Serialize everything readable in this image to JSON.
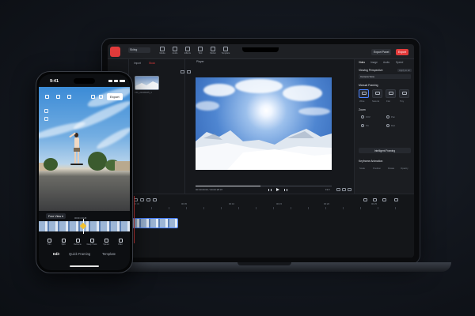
{
  "laptop": {
    "topbar": {
      "project_name": "Skiing",
      "tools": [
        "Media",
        "Audio",
        "Effects",
        "Text",
        "Sticker",
        "Template"
      ],
      "share_label": "Export Panel",
      "export_label": "Export"
    },
    "media": {
      "tabs": [
        "Import",
        "Stock"
      ],
      "clip_caption": "VID_20230105_1"
    },
    "preview": {
      "label": "Player",
      "timecode": "00:00:09:00 / 00:00:28:07",
      "zoom": "Fit ▾"
    },
    "properties": {
      "tabs": [
        "Video",
        "Image",
        "Audio",
        "Speed"
      ],
      "viewing_perspective_label": "Viewing Perspective",
      "apply_all_label": "Apply to all",
      "camera_view_value": "Camera View",
      "manual_framing_label": "Manual Framing",
      "framing_items": [
        "Wide",
        "Natural",
        "Flat",
        "Tiny"
      ],
      "zoom_label": "Zoom",
      "zoom_values": [
        "FOV",
        "Pan",
        "Tilt",
        "Roll"
      ],
      "intelligent_framing_label": "Intelligent Framing",
      "keyframe_label": "Keyframe Animation",
      "keyframe_items": [
        "Scale",
        "Position",
        "Rotate",
        "Opacity"
      ]
    },
    "timeline": {
      "tick_labels": [
        "00:00",
        "00:05",
        "00:10",
        "00:15",
        "00:20",
        "00:25"
      ]
    }
  },
  "phone": {
    "status_time": "9:41",
    "export_label": "Export",
    "free_view_label": "Free View ▾",
    "ruler_label": "00:09 / 00:28",
    "tools": [
      "Trim",
      "Split",
      "Reframe",
      "Deep Track",
      "Speed",
      "Filter"
    ],
    "tabs": [
      {
        "label": "Edit",
        "active": true
      },
      {
        "label": "Quick Framing",
        "active": false
      },
      {
        "label": "Template",
        "active": false
      }
    ]
  },
  "colors": {
    "accent_red": "#e33b3b",
    "selection_blue": "#4a82ff",
    "background": "#12161d"
  }
}
